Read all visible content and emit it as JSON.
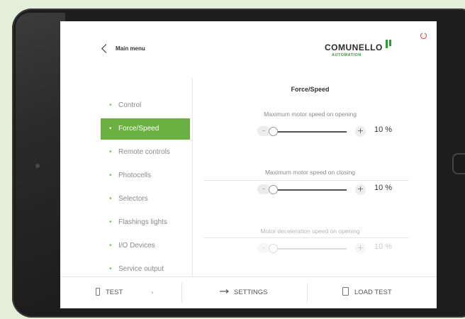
{
  "header": {
    "back_label": "Main menu",
    "logo_text": "COMUNELLO",
    "logo_sub": "AUTOMATION"
  },
  "sidebar": {
    "items": [
      {
        "label": "Control",
        "active": false
      },
      {
        "label": "Force/Speed",
        "active": true
      },
      {
        "label": "Remote controls",
        "active": false
      },
      {
        "label": "Photocells",
        "active": false
      },
      {
        "label": "Selectors",
        "active": false
      },
      {
        "label": "Flashings lights",
        "active": false
      },
      {
        "label": "I/O Devices",
        "active": false
      },
      {
        "label": "Service output",
        "active": false
      }
    ]
  },
  "main": {
    "title": "Force/Speed",
    "params": [
      {
        "label": "Maximum motor speed on opening",
        "value": "10 %",
        "level": 0.05,
        "enabled": true
      },
      {
        "label": "Maximum motor speed on closing",
        "value": "10 %",
        "level": 0.05,
        "enabled": true
      },
      {
        "label": "Motor deceleration speed on opening",
        "value": "10 %",
        "level": 0.05,
        "enabled": false
      }
    ],
    "minus": "–",
    "plus": "+"
  },
  "bottombar": {
    "test_label": "TEST",
    "test_arrow": "›",
    "settings_label": "SETTINGS",
    "load_test_label": "LOAD TEST"
  },
  "colors": {
    "accent": "#6bb043",
    "brand_green": "#2f9a35",
    "power": "#e53935"
  },
  "icons": [
    "back-chevron-icon",
    "power-icon",
    "phone-icon",
    "arrow-right-icon",
    "load-test-icon"
  ]
}
